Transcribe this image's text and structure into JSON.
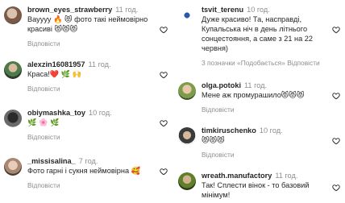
{
  "left": [
    {
      "user": "brown_eyes_strawberry",
      "time": "11 год.",
      "text": "Вауууу 🔥 😻 фото такі неймовірно красиві 😻😻😻",
      "meta": "Відповісти"
    },
    {
      "user": "alexzin16081957",
      "time": "11 год.",
      "text": "Краса!❤️ 🌿 🙌",
      "meta": "Відповісти"
    },
    {
      "user": "obiymashka_toy",
      "time": "10 год.",
      "text": "🌿 🌸 🌿",
      "meta": "Відповісти"
    },
    {
      "user": "_missisalina_",
      "time": "7 год.",
      "text": "Фото гарні і сукня неймовірна 🥰",
      "meta": "Відповісти"
    }
  ],
  "right": [
    {
      "user": "tsvit_terenu",
      "time": "10 год.",
      "text": "Дуже красиво! Та, насправді, Купальська ніч в день літнього сонцестояння, а саме з 21 на 22 червня)",
      "meta": "3 позначки «Подобається»   Відповісти"
    },
    {
      "user": "olga.potoki",
      "time": "11 год.",
      "text": "Мене аж промурашило😻😻😻",
      "meta": "Відповісти"
    },
    {
      "user": "timkiruschenko",
      "time": "10 год.",
      "text": "😻😻😻",
      "meta": "Відповісти"
    },
    {
      "user": "wreath.manufactory",
      "time": "11 год.",
      "text": "Так! Сплести вінок - то базовий мінімум!",
      "meta": "Відповісти"
    }
  ],
  "colors": {
    "username": "#262626",
    "muted": "#8e8e8e",
    "background": "#ffffff"
  },
  "icons": {
    "like": "heart-outline-icon"
  }
}
